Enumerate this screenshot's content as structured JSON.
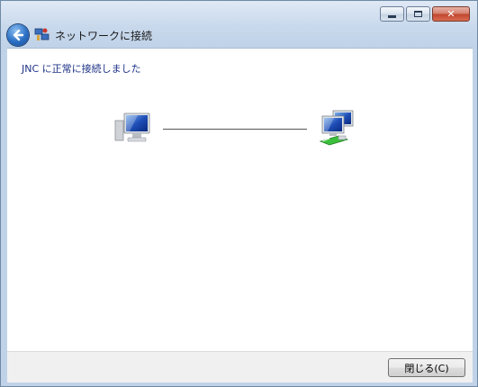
{
  "window": {
    "title": "ネットワークに接続"
  },
  "caption_buttons": {
    "minimize_icon": "minimize-icon",
    "maximize_icon": "maximize-icon",
    "close_glyph": "✕"
  },
  "content": {
    "message": "JNC に正常に接続しました",
    "left_icon": "computer-icon",
    "right_icon": "network-icon",
    "connection_status": "connected"
  },
  "footer": {
    "close_button_label": "閉じる(C)"
  },
  "colors": {
    "message_text": "#1e3287",
    "frame": "#bfd2e8",
    "footer_bg": "#f0f0f0"
  }
}
